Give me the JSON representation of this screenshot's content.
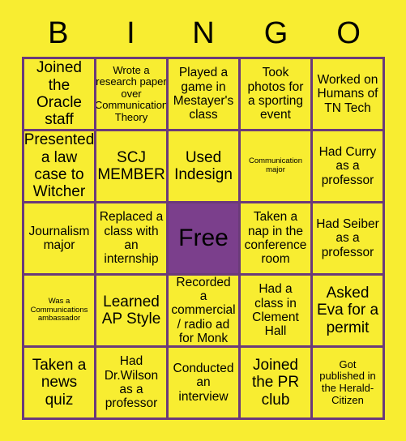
{
  "colors": {
    "background": "#f8ed31",
    "cell_fill": "#f8ed31",
    "border": "#6b3a7a",
    "free_fill": "#7b3f8c",
    "text": "#000000"
  },
  "header": {
    "letters": [
      "B",
      "I",
      "N",
      "G",
      "O"
    ]
  },
  "card": {
    "rows": 5,
    "columns": 5,
    "cells": [
      {
        "text": "Joined the Oracle staff",
        "size": "sz-lg",
        "free": false
      },
      {
        "text": "Wrote a research paper over Communication Theory",
        "size": "sz-sm",
        "free": false
      },
      {
        "text": "Played a game in Mestayer's class",
        "size": "sz-md",
        "free": false
      },
      {
        "text": "Took photos for a sporting event",
        "size": "sz-md",
        "free": false
      },
      {
        "text": "Worked on Humans of TN Tech",
        "size": "sz-md",
        "free": false
      },
      {
        "text": "Presented a law case to Witcher",
        "size": "sz-lg",
        "free": false
      },
      {
        "text": "SCJ MEMBER",
        "size": "sz-lg",
        "free": false
      },
      {
        "text": "Used Indesign",
        "size": "sz-lg",
        "free": false
      },
      {
        "text": "Communication major",
        "size": "sz-xs",
        "free": false
      },
      {
        "text": "Had Curry as a professor",
        "size": "sz-md",
        "free": false
      },
      {
        "text": "Journalism major",
        "size": "sz-md",
        "free": false
      },
      {
        "text": "Replaced a class with an internship",
        "size": "sz-md",
        "free": false
      },
      {
        "text": "Free",
        "size": "sz-xl",
        "free": true
      },
      {
        "text": "Taken a nap in the conference room",
        "size": "sz-md",
        "free": false
      },
      {
        "text": "Had Seiber as a professor",
        "size": "sz-md",
        "free": false
      },
      {
        "text": "Was a Communications ambassador",
        "size": "sz-xs",
        "free": false
      },
      {
        "text": "Learned AP Style",
        "size": "sz-lg",
        "free": false
      },
      {
        "text": "Recorded a commercial / radio ad for Monk",
        "size": "sz-md",
        "free": false
      },
      {
        "text": "Had a class in Clement Hall",
        "size": "sz-md",
        "free": false
      },
      {
        "text": "Asked Eva for a permit",
        "size": "sz-lg",
        "free": false
      },
      {
        "text": "Taken a news quiz",
        "size": "sz-lg",
        "free": false
      },
      {
        "text": "Had Dr.Wilson as a professor",
        "size": "sz-md",
        "free": false
      },
      {
        "text": "Conducted an interview",
        "size": "sz-md",
        "free": false
      },
      {
        "text": "Joined the PR club",
        "size": "sz-lg",
        "free": false
      },
      {
        "text": "Got published in the Herald-Citizen",
        "size": "sz-sm",
        "free": false
      }
    ]
  }
}
